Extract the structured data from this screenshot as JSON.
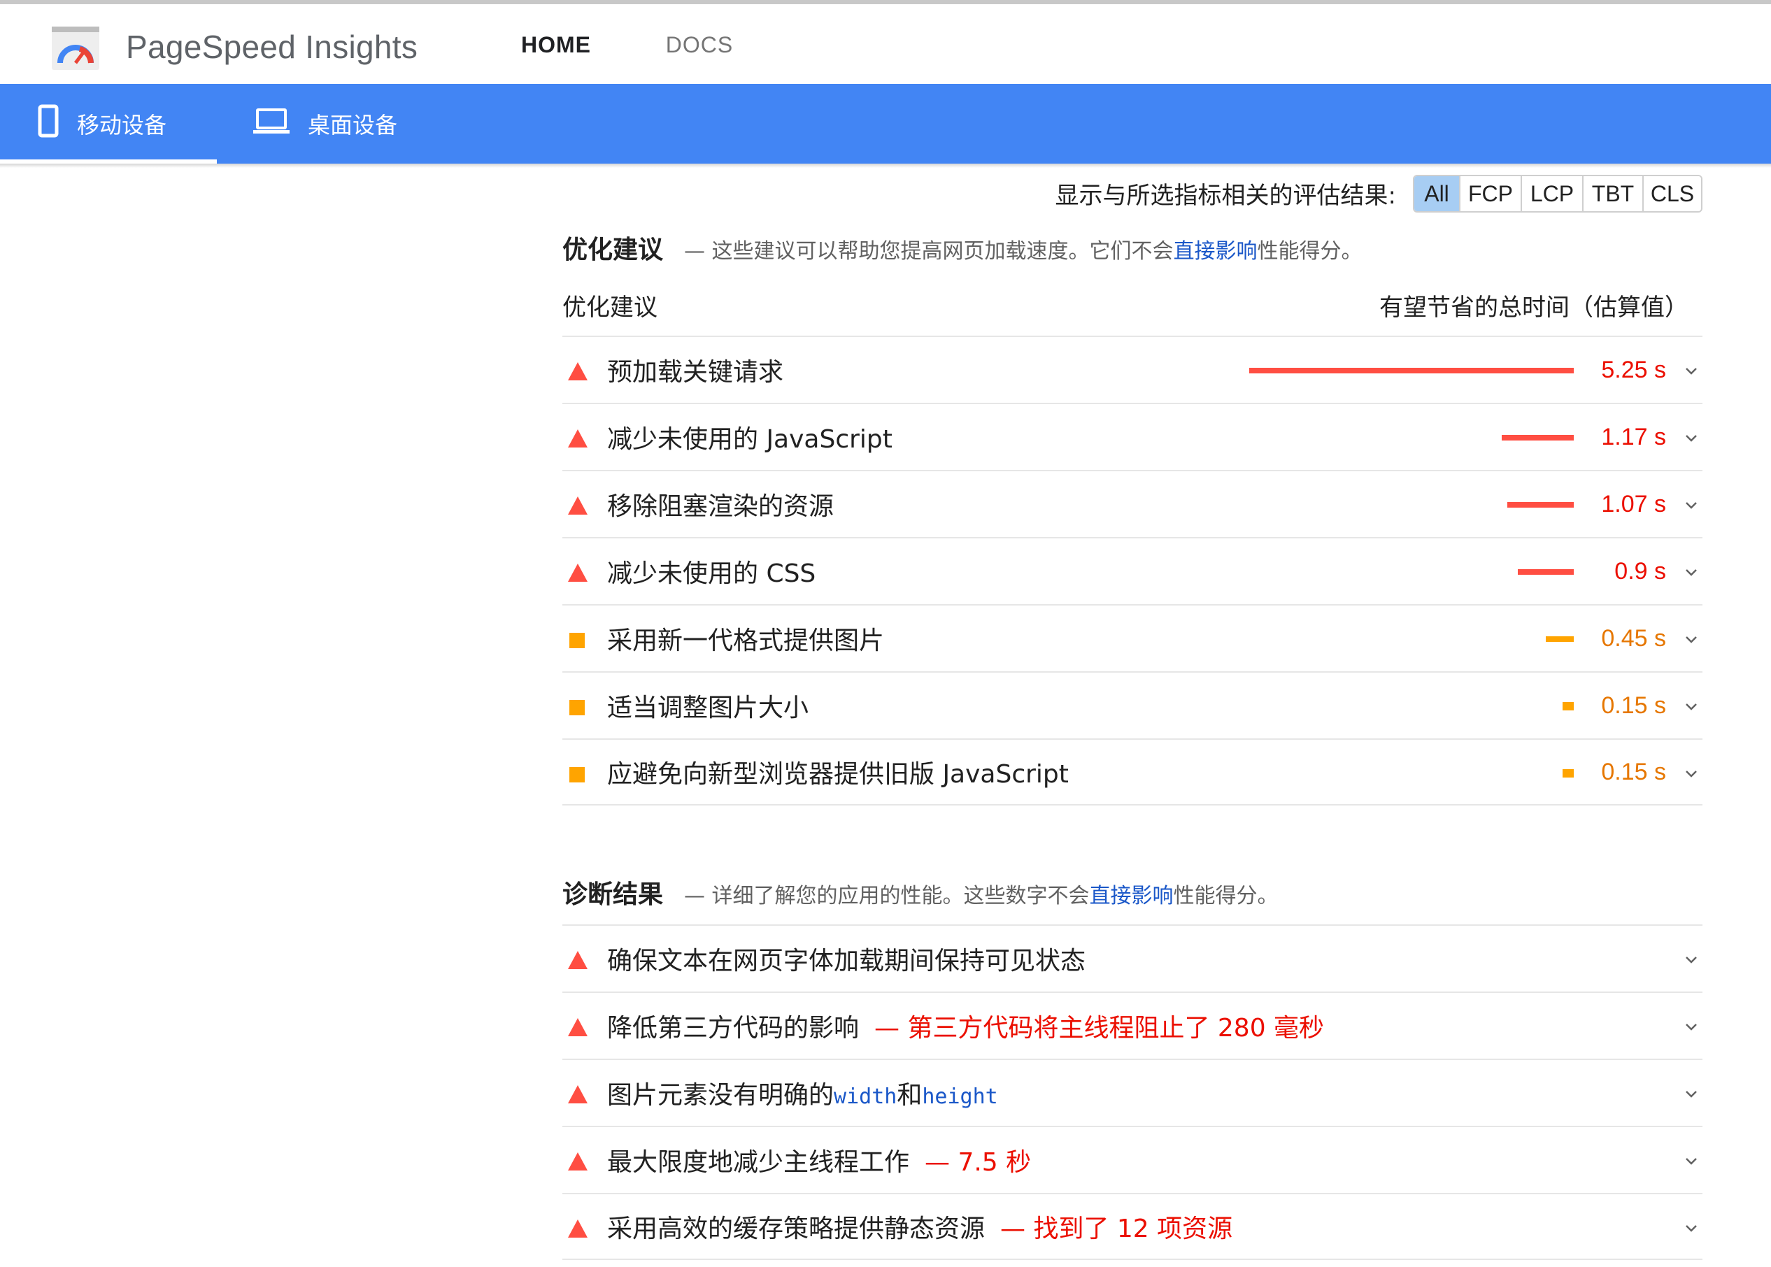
{
  "header": {
    "app_title": "PageSpeed Insights",
    "logo_icon": "pagespeed-gauge-icon",
    "tabs": [
      {
        "label": "HOME",
        "active": true
      },
      {
        "label": "DOCS",
        "active": false
      }
    ]
  },
  "device_bar": {
    "color": "#4285f4",
    "tabs": [
      {
        "label": "移动设备",
        "icon": "smartphone-icon",
        "active": true
      },
      {
        "label": "桌面设备",
        "icon": "laptop-icon",
        "active": false
      }
    ]
  },
  "filter": {
    "label": "显示与所选指标相关的评估结果:",
    "options": [
      "All",
      "FCP",
      "LCP",
      "TBT",
      "CLS"
    ],
    "selected": "All"
  },
  "opportunities": {
    "title": "优化建议",
    "desc_before": "— 这些建议可以帮助您提高网页加载速度。它们不会",
    "desc_link": "直接影响",
    "desc_after": "性能得分。",
    "col_left": "优化建议",
    "col_right": "有望节省的总时间（估算值）",
    "items": [
      {
        "label": "预加载关键请求",
        "value": "5.25 s",
        "seconds": 5.25,
        "severity": "fail"
      },
      {
        "label": "减少未使用的 JavaScript",
        "value": "1.17 s",
        "seconds": 1.17,
        "severity": "fail"
      },
      {
        "label": "移除阻塞渲染的资源",
        "value": "1.07 s",
        "seconds": 1.07,
        "severity": "fail"
      },
      {
        "label": "减少未使用的 CSS",
        "value": "0.9 s",
        "seconds": 0.9,
        "severity": "fail"
      },
      {
        "label": "采用新一代格式提供图片",
        "value": "0.45 s",
        "seconds": 0.45,
        "severity": "average"
      },
      {
        "label": "适当调整图片大小",
        "value": "0.15 s",
        "seconds": 0.15,
        "severity": "average"
      },
      {
        "label": "应避免向新型浏览器提供旧版 JavaScript",
        "value": "0.15 s",
        "seconds": 0.15,
        "severity": "average"
      }
    ]
  },
  "diagnostics": {
    "title": "诊断结果",
    "desc_before": "— 详细了解您的应用的性能。这些数字不会",
    "desc_link": "直接影响",
    "desc_after": "性能得分。",
    "items": [
      {
        "label": "确保文本在网页字体加载期间保持可见状态",
        "extra": ""
      },
      {
        "label": "降低第三方代码的影响",
        "extra": "— 第三方代码将主线程阻止了 280 毫秒"
      },
      {
        "label_parts": [
          "图片元素没有明确的",
          "width",
          "和",
          "height"
        ],
        "extra": ""
      },
      {
        "label": "最大限度地减少主线程工作",
        "extra": "— 7.5 秒"
      },
      {
        "label": "采用高效的缓存策略提供静态资源",
        "extra": "— 找到了 12 项资源"
      }
    ]
  },
  "colors": {
    "fail": "#eb0f00",
    "fail_bar": "#ff4e42",
    "average": "#ffa400",
    "average_text": "#e67700"
  }
}
